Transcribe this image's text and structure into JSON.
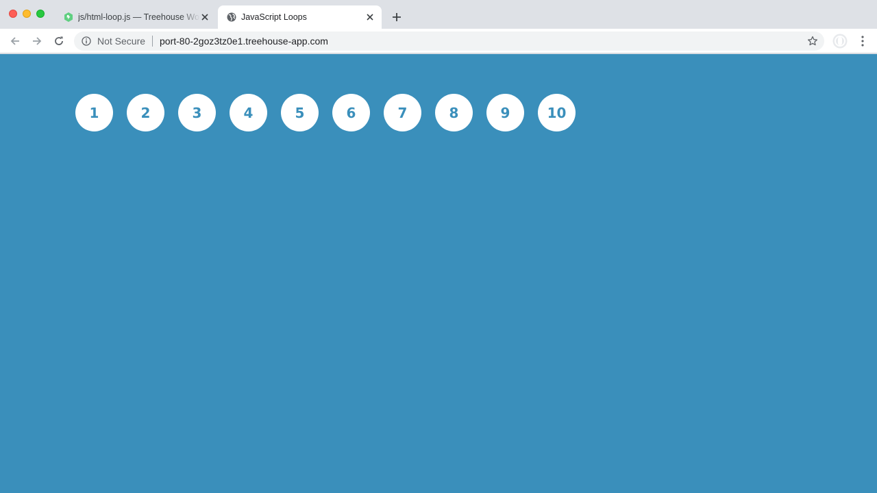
{
  "window": {
    "controls": [
      "close",
      "minimize",
      "maximize"
    ]
  },
  "tabs": [
    {
      "title": "js/html-loop.js — Treehouse Workspaces",
      "favicon": "treehouse-icon",
      "active": false
    },
    {
      "title": "JavaScript Loops",
      "favicon": "globe-icon",
      "active": true
    }
  ],
  "toolbar": {
    "security_label": "Not Secure",
    "url": "port-80-2goz3tz0e1.treehouse-app.com"
  },
  "page": {
    "background": "#3a8fbb",
    "circle_color": "#ffffff",
    "circles": [
      "1",
      "2",
      "3",
      "4",
      "5",
      "6",
      "7",
      "8",
      "9",
      "10"
    ]
  }
}
